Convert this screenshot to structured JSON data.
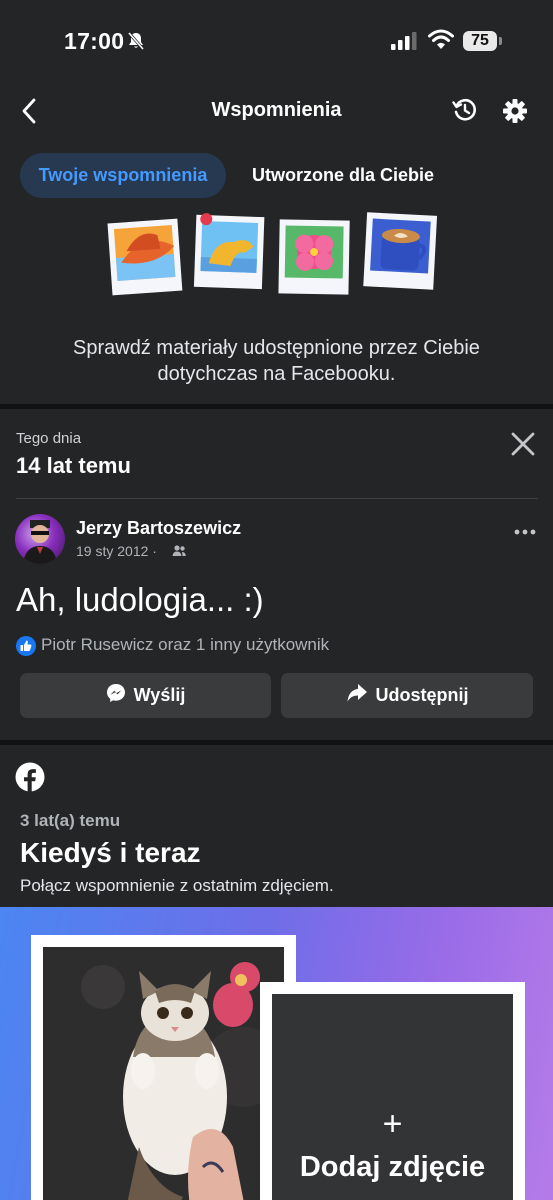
{
  "status_bar": {
    "time": "17:00",
    "battery": "75"
  },
  "header": {
    "title": "Wspomnienia"
  },
  "tabs": [
    {
      "label": "Twoje wspomnienia",
      "active": true
    },
    {
      "label": "Utworzone dla Ciebie",
      "active": false
    }
  ],
  "hero": {
    "text": "Sprawdź materiały udostępnione przez Ciebie dotychczas na Facebooku."
  },
  "memory": {
    "subtitle": "Tego dnia",
    "title": "14 lat temu",
    "author": "Jerzy Bartoszewicz",
    "date": "19 sty 2012 ·",
    "post_text": "Ah, ludologia... :)",
    "reactions": "Piotr Rusewicz oraz 1 inny użytkownik",
    "send_label": "Wyślij",
    "share_label": "Udostępnij"
  },
  "then_now": {
    "subtitle": "3 lat(a) temu",
    "title": "Kiedyś i teraz",
    "description": "Połącz wspomnienie z ostatnim zdjęciem.",
    "plus": "+",
    "add_label": "Dodaj zdjęcie"
  },
  "colors": {
    "background": "#242526",
    "accent": "#4599ff",
    "tab_active_bg": "#263951",
    "button_bg": "#3a3b3c",
    "facebook_blue": "#1877f2"
  },
  "icons": [
    "bell-off-icon",
    "signal-icon",
    "wifi-icon",
    "battery-icon",
    "back-icon",
    "history-icon",
    "gear-icon",
    "close-icon",
    "friends-icon",
    "more-icon",
    "like-icon",
    "messenger-icon",
    "share-icon",
    "facebook-icon"
  ]
}
